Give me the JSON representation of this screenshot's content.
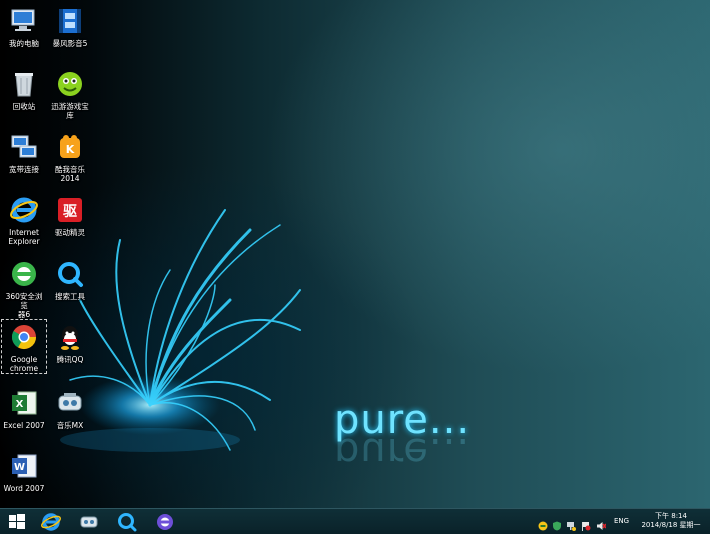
{
  "desktop": {
    "wallpaper_text": "pure...",
    "icons": [
      {
        "label": "我的电脑",
        "icon": "computer-icon"
      },
      {
        "label": "暴风影音5",
        "icon": "storm-player-icon"
      },
      {
        "label": "回收站",
        "icon": "recycle-bin-icon"
      },
      {
        "label": "迅游游戏宝库",
        "icon": "game-center-icon"
      },
      {
        "label": "宽带连接",
        "icon": "network-icon"
      },
      {
        "label": "酷我音乐\n2014",
        "icon": "kuwo-music-icon"
      },
      {
        "label": "Internet\nExplorer",
        "icon": "ie-icon"
      },
      {
        "label": "驱动精灵",
        "icon": "driver-genius-icon"
      },
      {
        "label": "360安全浏览\n器6",
        "icon": "360-browser-icon"
      },
      {
        "label": "搜索工具",
        "icon": "search-tool-icon"
      },
      {
        "label": "Google\nchrome",
        "icon": "chrome-icon"
      },
      {
        "label": "腾讯QQ",
        "icon": "qq-icon"
      },
      {
        "label": "Excel 2007",
        "icon": "excel-icon"
      },
      {
        "label": "音乐MX",
        "icon": "music-mx-icon"
      },
      {
        "label": "Word 2007",
        "icon": "word-icon"
      }
    ]
  },
  "taskbar": {
    "pinned": [
      "start-icon",
      "ie-icon",
      "music-mx-icon",
      "search-tool-icon",
      "360-browser-icon"
    ],
    "tray": {
      "language": "ENG",
      "time": "下午 8:14",
      "date": "2014/8/18 星期一"
    }
  },
  "colors": {
    "accent": "#33ccff",
    "taskbar": "#0f2f37"
  }
}
